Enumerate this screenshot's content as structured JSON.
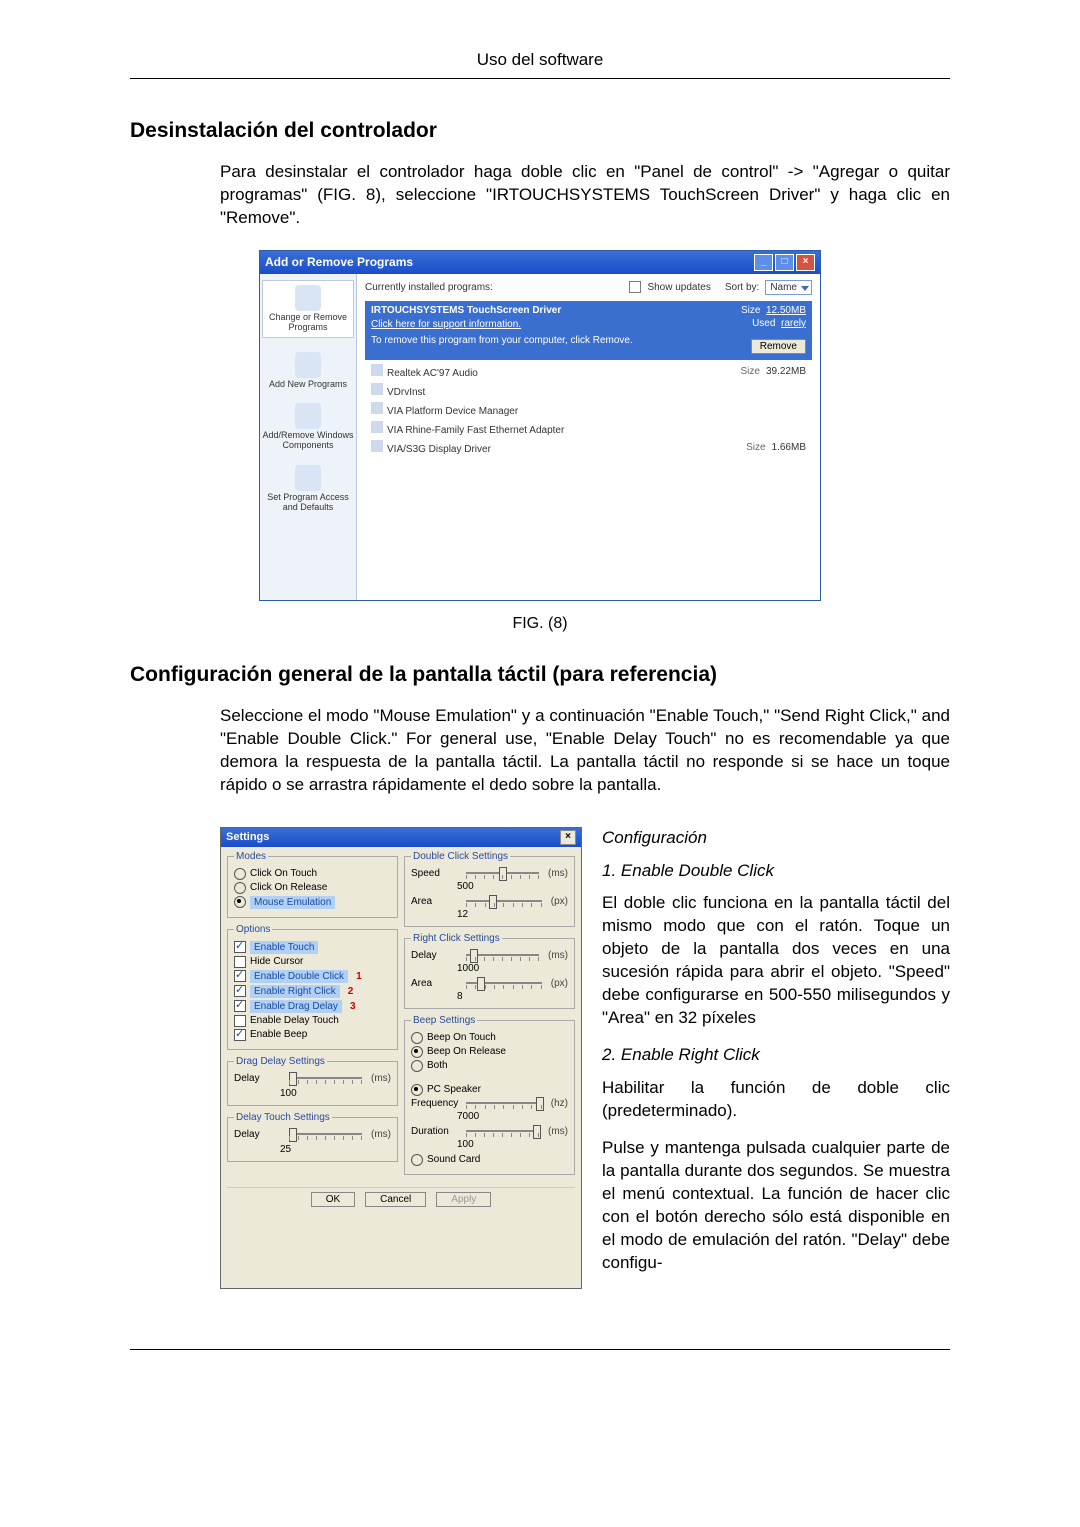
{
  "page": {
    "header": "Uso del software",
    "section1_title": "Desinstalación del controlador",
    "section1_para": "Para desinstalar el controlador haga doble clic en \"Panel de control\" -> \"Agregar o quitar programas\" (FIG. 8), seleccione \"IRTOUCHSYSTEMS TouchScreen Driver\" y haga clic en \"Remove\".",
    "fig8_caption": "FIG. (8)",
    "section2_title": "Configuración general de la pantalla táctil (para referencia)",
    "section2_para": "Seleccione el modo \"Mouse Emulation\" y a continuación \"Enable Touch,\" \"Send Right Click,\" and \"Enable Double Click.\" For general use, \"Enable Delay Touch\" no es recomendable ya que demora la respuesta de la pantalla táctil. La pantalla táctil no responde si se hace un toque rápido o se arrastra rápidamente el dedo sobre la pantalla."
  },
  "fig8": {
    "title": "Add or Remove Programs",
    "side": {
      "items": [
        "Change or Remove Programs",
        "Add New Programs",
        "Add/Remove Windows Components",
        "Set Program Access and Defaults"
      ]
    },
    "top": {
      "label": "Currently installed programs:",
      "show_updates": "Show updates",
      "sort_by": "Sort by:",
      "sort_value": "Name"
    },
    "selected": {
      "name": "IRTOUCHSYSTEMS TouchScreen Driver",
      "support_link": "Click here for support information.",
      "remove_text": "To remove this program from your computer, click Remove.",
      "size_label": "Size",
      "size_value": "12.50MB",
      "used_label": "Used",
      "used_value": "rarely",
      "remove_button": "Remove"
    },
    "rows": [
      {
        "name": "Realtek AC'97 Audio",
        "size_label": "Size",
        "size": "39.22MB"
      },
      {
        "name": "VDrvInst",
        "size_label": "",
        "size": ""
      },
      {
        "name": "VIA Platform Device Manager",
        "size_label": "",
        "size": ""
      },
      {
        "name": "VIA Rhine-Family Fast Ethernet Adapter",
        "size_label": "",
        "size": ""
      },
      {
        "name": "VIA/S3G Display Driver",
        "size_label": "Size",
        "size": "1.66MB"
      }
    ]
  },
  "settings": {
    "title": "Settings",
    "modes": {
      "legend": "Modes",
      "click_on_touch": "Click On Touch",
      "click_on_release": "Click On Release",
      "mouse_emulation": "Mouse Emulation"
    },
    "options": {
      "legend": "Options",
      "enable_touch": "Enable Touch",
      "hide_cursor": "Hide Cursor",
      "enable_double_click": "Enable Double Click",
      "enable_right_click": "Enable Right Click",
      "enable_drag_delay": "Enable Drag Delay",
      "enable_delay_touch": "Enable Delay Touch",
      "enable_beep": "Enable Beep",
      "badge1": "1",
      "badge2": "2",
      "badge3": "3"
    },
    "drag_delay": {
      "legend": "Drag Delay Settings",
      "delay_label": "Delay",
      "delay_value": "100",
      "unit": "(ms)"
    },
    "delay_touch": {
      "legend": "Delay Touch Settings",
      "delay_label": "Delay",
      "delay_value": "25",
      "unit": "(ms)"
    },
    "double_click": {
      "legend": "Double Click Settings",
      "speed_label": "Speed",
      "speed_value": "500",
      "speed_unit": "(ms)",
      "area_label": "Area",
      "area_value": "12",
      "area_unit": "(px)"
    },
    "right_click": {
      "legend": "Right Click Settings",
      "delay_label": "Delay",
      "delay_value": "1000",
      "delay_unit": "(ms)",
      "area_label": "Area",
      "area_value": "8",
      "area_unit": "(px)"
    },
    "beep": {
      "legend": "Beep Settings",
      "beep_on_touch": "Beep On Touch",
      "beep_on_release": "Beep On Release",
      "both": "Both",
      "pc_speaker": "PC Speaker",
      "frequency_label": "Frequency",
      "frequency_value": "7000",
      "frequency_unit": "(hz)",
      "duration_label": "Duration",
      "duration_value": "100",
      "duration_unit": "(ms)",
      "sound_card": "Sound Card"
    },
    "buttons": {
      "ok": "OK",
      "cancel": "Cancel",
      "apply": "Apply"
    }
  },
  "config": {
    "heading": "Configuración",
    "item1_title": "1. Enable Double Click",
    "item1_body": "El doble clic funciona en la pantalla táctil del mismo modo que con el ratón. Toque un objeto de la pantalla dos veces en una sucesión rápida para abrir el objeto. \"Speed\" debe configurarse en 500-550 milisegundos y \"Area\" en 32 píxeles",
    "item2_title": "2. Enable Right Click",
    "item2_body1": "Habilitar la función de doble clic (predeterminado).",
    "item2_body2": "Pulse y mantenga pulsada cualquier parte de la pantalla durante dos segundos. Se muestra el menú contextual. La función de hacer clic con el botón derecho sólo está disponible en el modo de emulación del ratón. \"Delay\" debe configu-"
  }
}
